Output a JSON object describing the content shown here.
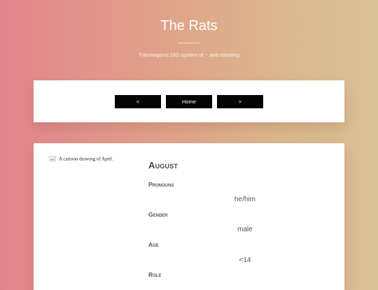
{
  "header": {
    "title": "The Rats",
    "subtitle": "Traumagenic DID system of ~ and counting"
  },
  "nav": {
    "prev_label": "<",
    "home_label": "Home",
    "next_label": ">"
  },
  "profile": {
    "avatar_alt": "A cartoon drawing of April.",
    "name": "August",
    "fields": [
      {
        "label": "Pronouns",
        "value": "he/him"
      },
      {
        "label": "Gender",
        "value": "male"
      },
      {
        "label": "Age",
        "value": "<14"
      },
      {
        "label": "Role",
        "value": ""
      }
    ]
  },
  "colors": {
    "gradient_left": "#e3848d",
    "gradient_right": "#d9c094",
    "button_bg": "#050505",
    "card_bg": "#ffffff"
  }
}
